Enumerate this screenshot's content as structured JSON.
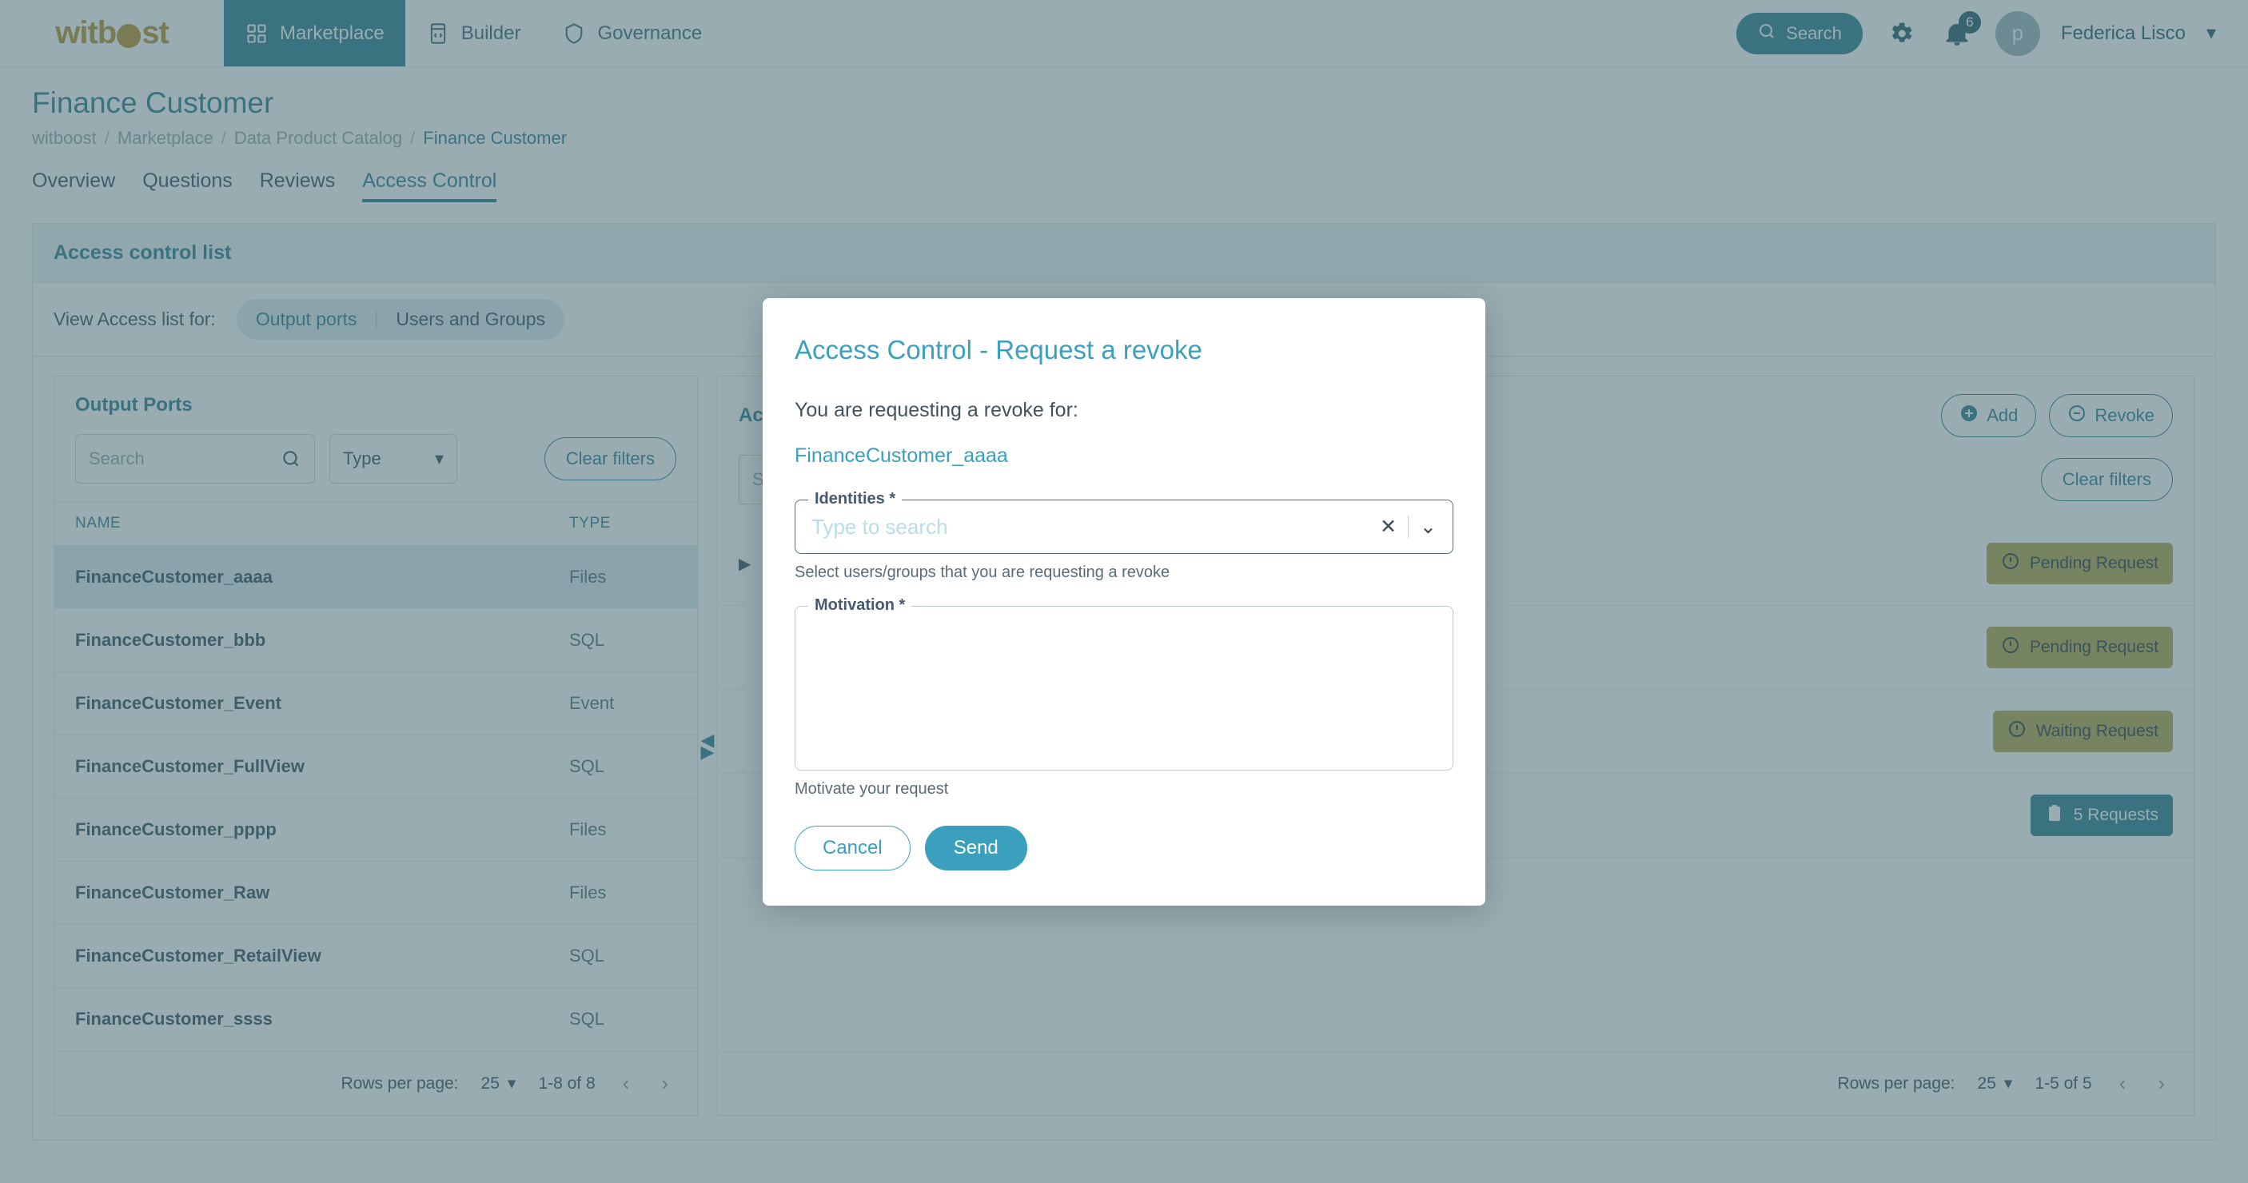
{
  "colors": {
    "accent_teal": "#2f7e8f",
    "modal_accent": "#3aa0bd",
    "brand_gold": "#b8922e",
    "badge_warning": "#b6a64f",
    "overlay": "rgba(68,103,114,0.55)"
  },
  "navbar": {
    "brand": "witb",
    "brand_suffix": "st",
    "items": [
      {
        "label": "Marketplace",
        "icon": "grid-icon",
        "active": true
      },
      {
        "label": "Builder",
        "icon": "code-icon",
        "active": false
      },
      {
        "label": "Governance",
        "icon": "shield-icon",
        "active": false
      }
    ],
    "search_label": "Search",
    "notification_count": "6",
    "avatar_initial": "p",
    "user_name": "Federica Lisco"
  },
  "page": {
    "title": "Finance Customer",
    "breadcrumb": [
      "witboost",
      "Marketplace",
      "Data Product Catalog",
      "Finance Customer"
    ],
    "tabs": [
      {
        "label": "Overview",
        "active": false
      },
      {
        "label": "Questions",
        "active": false
      },
      {
        "label": "Reviews",
        "active": false
      },
      {
        "label": "Access Control",
        "active": true
      }
    ]
  },
  "acl": {
    "header": "Access control list",
    "view_label": "View Access list for:",
    "segments": [
      {
        "label": "Output ports",
        "active": true
      },
      {
        "label": "Users and Groups",
        "active": false
      }
    ]
  },
  "left_panel": {
    "title": "Output Ports",
    "search_placeholder": "Search",
    "search_value": "",
    "type_label": "Type",
    "clear_filters": "Clear filters",
    "columns": [
      "NAME",
      "TYPE"
    ],
    "rows": [
      {
        "name": "FinanceCustomer_aaaa",
        "type": "Files",
        "selected": true
      },
      {
        "name": "FinanceCustomer_bbb",
        "type": "SQL",
        "selected": false
      },
      {
        "name": "FinanceCustomer_Event",
        "type": "Event",
        "selected": false
      },
      {
        "name": "FinanceCustomer_FullView",
        "type": "SQL",
        "selected": false
      },
      {
        "name": "FinanceCustomer_pppp",
        "type": "Files",
        "selected": false
      },
      {
        "name": "FinanceCustomer_Raw",
        "type": "Files",
        "selected": false
      },
      {
        "name": "FinanceCustomer_RetailView",
        "type": "SQL",
        "selected": false
      },
      {
        "name": "FinanceCustomer_ssss",
        "type": "SQL",
        "selected": false
      }
    ],
    "pagination": {
      "rows_per_page_label": "Rows per page:",
      "rows_per_page_value": "25",
      "range": "1-8 of 8"
    }
  },
  "right_panel": {
    "title": "Acce",
    "add_label": "Add",
    "revoke_label": "Revoke",
    "search_placeholder": "Se",
    "clear_filters": "Clear filters",
    "rows": [
      {
        "badge": "Pending Request",
        "badge_type": "warn"
      },
      {
        "badge": "Pending Request",
        "badge_type": "warn"
      },
      {
        "badge": "Waiting Request",
        "badge_type": "warn"
      },
      {
        "badge": "5 Requests",
        "badge_type": "info"
      }
    ],
    "pagination": {
      "rows_per_page_label": "Rows per page:",
      "rows_per_page_value": "25",
      "range": "1-5 of 5"
    }
  },
  "modal": {
    "title": "Access Control - Request a revoke",
    "lead": "You are requesting a revoke for:",
    "target": "FinanceCustomer_aaaa",
    "identities": {
      "legend": "Identities *",
      "placeholder": "Type to search",
      "value": "",
      "helper": "Select users/groups that you are requesting a revoke"
    },
    "motivation": {
      "legend": "Motivation *",
      "value": "",
      "helper": "Motivate your request"
    },
    "cancel_label": "Cancel",
    "send_label": "Send"
  }
}
